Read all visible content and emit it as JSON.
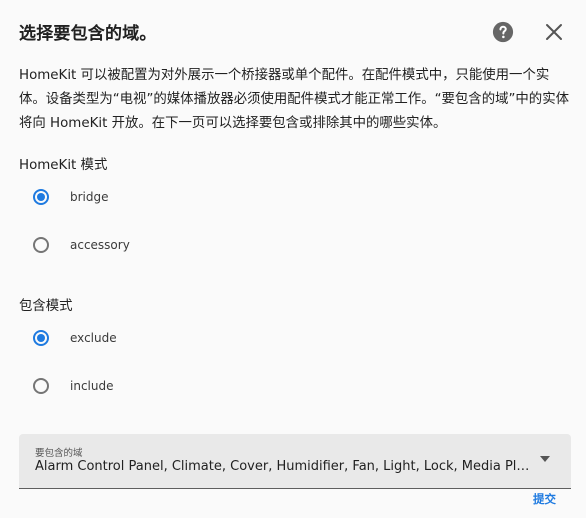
{
  "dialog": {
    "title": "选择要包含的域。",
    "description": "HomeKit 可以被配置为对外展示一个桥接器或单个配件。在配件模式中，只能使用一个实体。设备类型为“电视”的媒体播放器必须使用配件模式才能正常工作。“要包含的域”中的实体将向 HomeKit 开放。在下一页可以选择要包含或排除其中的哪些实体。",
    "help_icon": "help-circle-icon",
    "close_icon": "close-icon"
  },
  "homekit_mode": {
    "label": "HomeKit 模式",
    "options": [
      {
        "label": "bridge",
        "checked": true
      },
      {
        "label": "accessory",
        "checked": false
      }
    ]
  },
  "include_mode": {
    "label": "包含模式",
    "options": [
      {
        "label": "exclude",
        "checked": true
      },
      {
        "label": "include",
        "checked": false
      }
    ]
  },
  "domains_select": {
    "label": "要包含的域",
    "value": "Alarm Control Panel, Climate, Cover, Humidifier, Fan, Light, Lock, Media Player, Remote, Switch, Vacuum, Water Heater"
  },
  "actions": {
    "submit_label": "提交"
  },
  "colors": {
    "accent": "#1e7ae0",
    "radio_unchecked": "#757575",
    "field_background": "#e9e9e9"
  }
}
